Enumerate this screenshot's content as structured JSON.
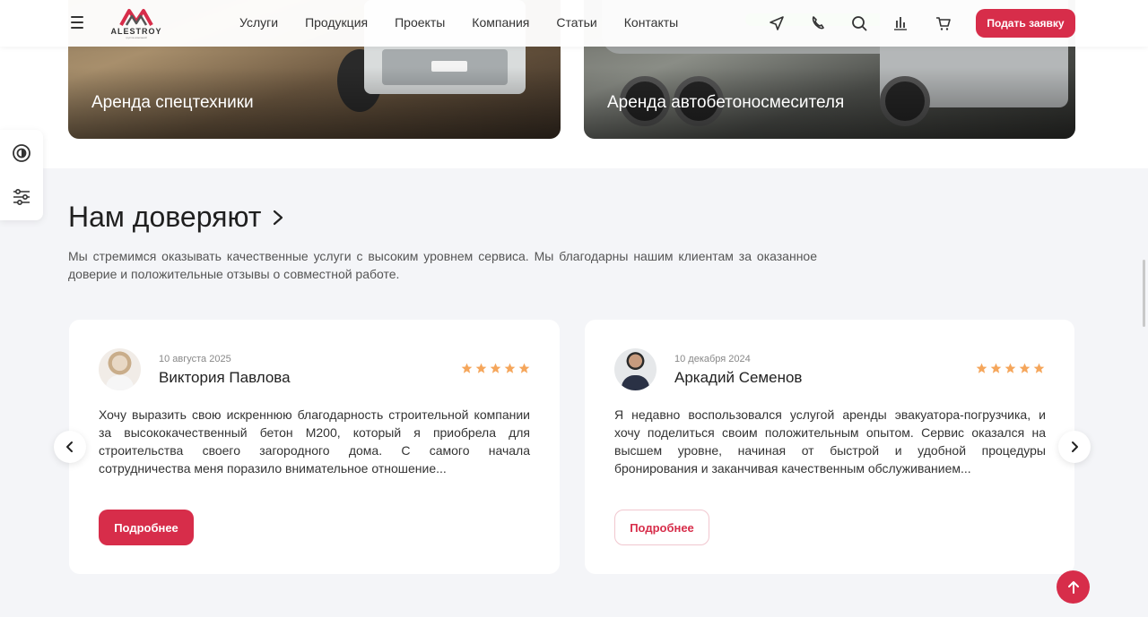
{
  "header": {
    "logo_text": "ALESTROY",
    "logo_sub": "группа компаний",
    "nav": [
      "Услуги",
      "Продукция",
      "Проекты",
      "Компания",
      "Статьи",
      "Контакты"
    ],
    "cta_label": "Подать заявку",
    "icons": [
      "send-icon",
      "phone-icon",
      "search-icon",
      "compare-icon",
      "cart-icon"
    ]
  },
  "services": [
    {
      "title": "Аренда спецтехники"
    },
    {
      "title": "Аренда автобетоносмесителя"
    }
  ],
  "side_panel": {
    "icons": [
      "accessibility-icon",
      "settings-sliders-icon"
    ]
  },
  "section": {
    "title": "Нам доверяют",
    "description": "Мы стремимся оказывать качественные услуги с высоким уровнем сервиса. Мы благодарны нашим клиентам за оказанное доверие и положительные отзывы о совместной работе."
  },
  "reviews": [
    {
      "date": "10 августа 2025",
      "name": "Виктория Павлова",
      "rating": 5,
      "text": "Хочу выразить свою искреннюю благодарность строительной компании за высококачественный бетон М200, который я приобрела для строительства своего загородного дома. С самого начала сотрудничества меня поразило внимательное отношение...",
      "button": "Подробнее"
    },
    {
      "date": "10 декабря 2024",
      "name": "Аркадий Семенов",
      "rating": 5,
      "text": "Я недавно воспользовался услугой аренды эвакуатора-погрузчика, и хочу поделиться своим положительным опытом. Сервис оказался на высшем уровне, начиная от быстрой и удобной процедуры бронирования и заканчивая качественным обслуживанием...",
      "button": "Подробнее"
    }
  ],
  "colors": {
    "accent": "#d72d4a",
    "star": "#f5a65b",
    "background": "#f4f5f8"
  }
}
